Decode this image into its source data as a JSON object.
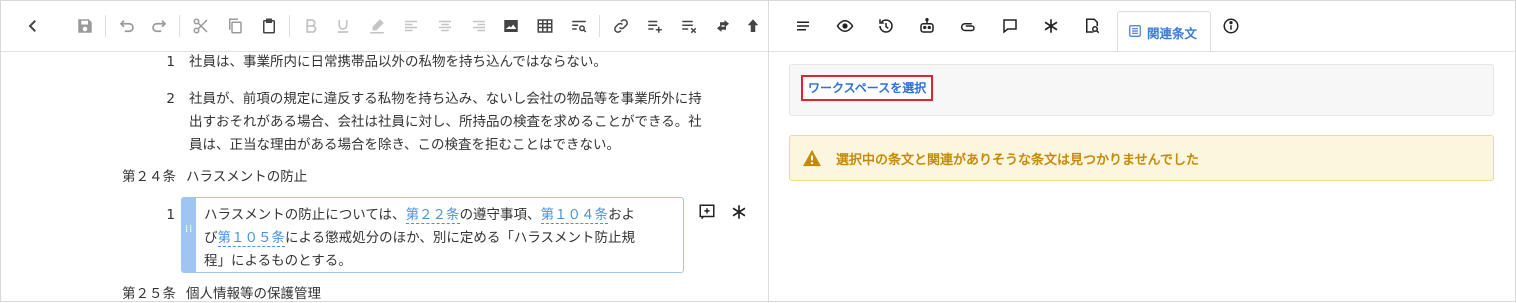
{
  "editor": {
    "paragraphs": [
      {
        "num": "1",
        "lines": [
          "社員は、事業所内に日常携帯品以外の私物を持ち込んではならない。"
        ]
      },
      {
        "num": "2",
        "lines": [
          "社員が、前項の規定に違反する私物を持ち込み、ないし会社の物品等を事業所外に持",
          "出すおそれがある場合、会社は社員に対し、所持品の検査を求めることができる。社",
          "員は、正当な理由がある場合を除き、この検査を拒むことはできない。"
        ]
      }
    ],
    "article24": {
      "num": "第２４条",
      "title": "ハラスメントの防止"
    },
    "active_paragraph": {
      "num": "1",
      "line1_before": "ハラスメントの防止については、",
      "link1": "第２２条",
      "line1_mid": "の遵守事項、",
      "link2": "第１０４条",
      "line1_after": "およ",
      "line2_before": "び",
      "link3": "第１０５条",
      "line2_after": "による懲戒処分のほか、別に定める「ハラスメント防止規",
      "line3": "程」によるものとする。"
    },
    "article25": {
      "num": "第２５条",
      "title": "個人情報等の保護管理"
    }
  },
  "right_panel": {
    "active_tab_label": "関連条文",
    "workspace_button": "ワークスペースを選択",
    "warning_text": "選択中の条文と関連がありそうな条文は見つかりませんでした",
    "colors": {
      "accent": "#3d7bd9",
      "warning": "#c58a0a",
      "highlight_border": "#e0242a"
    }
  }
}
